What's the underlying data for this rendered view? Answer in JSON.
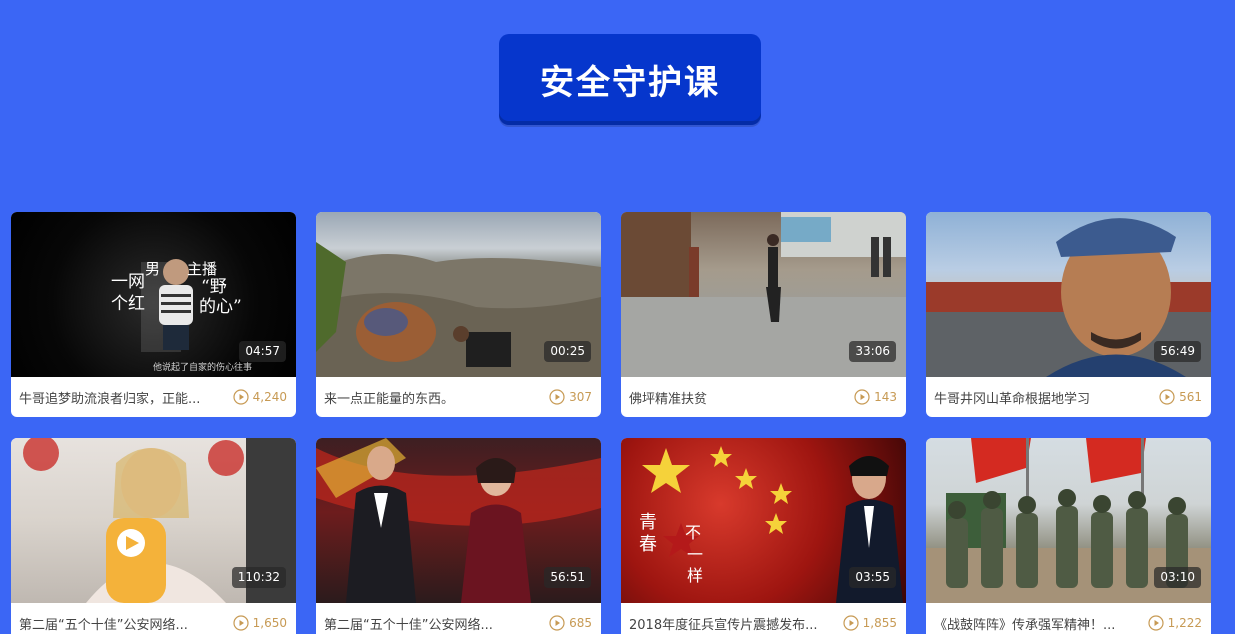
{
  "header": {
    "title": "安全守护课"
  },
  "videos": [
    {
      "title": "牛哥追梦助流浪者归家，正能...",
      "duration": "04:57",
      "views": "4,240",
      "thumb_text": "一网红男主播个野的心",
      "thumb_caption": "他说起了自家的伤心往事"
    },
    {
      "title": "来一点正能量的东西。",
      "duration": "00:25",
      "views": "307"
    },
    {
      "title": "佛坪精准扶贫",
      "duration": "33:06",
      "views": "143"
    },
    {
      "title": "牛哥井冈山革命根据地学习",
      "duration": "56:49",
      "views": "561"
    },
    {
      "title": "第二届“五个十佳”公安网络...",
      "duration": "110:32",
      "views": "1,650"
    },
    {
      "title": "第二届“五个十佳”公安网络...",
      "duration": "56:51",
      "views": "685"
    },
    {
      "title": "2018年度征兵宣传片震撼发布...",
      "duration": "03:55",
      "views": "1,855",
      "thumb_text": "青春不一样"
    },
    {
      "title": "《战鼓阵阵》传承强军精神！...",
      "duration": "03:10",
      "views": "1,222"
    }
  ],
  "colors": {
    "background": "#3b66f5",
    "header_badge": "#0636cc",
    "views_accent": "#c79a54"
  },
  "icons": {
    "views": "play-circle-icon"
  }
}
